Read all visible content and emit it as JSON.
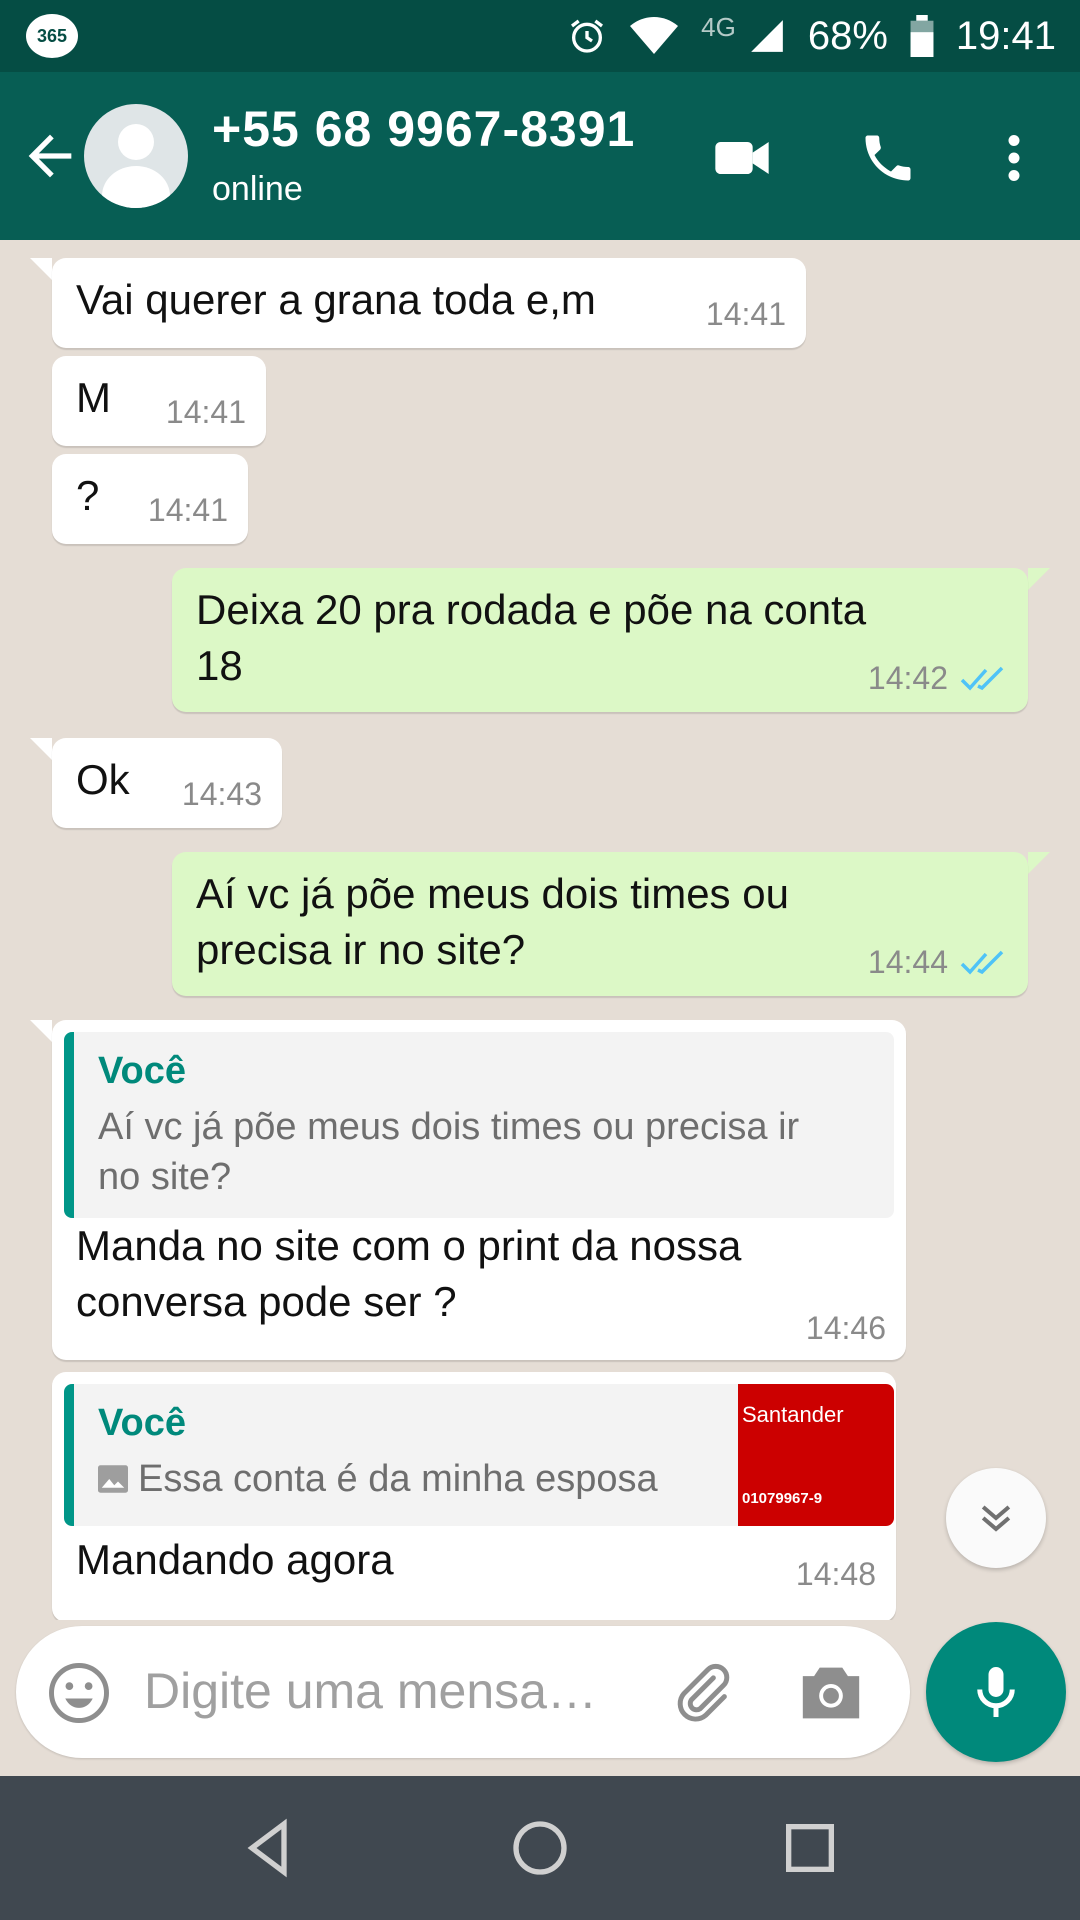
{
  "status_bar": {
    "app_badge": "365",
    "network": "4G",
    "battery": "68%",
    "time": "19:41",
    "icons": [
      "alarm-icon",
      "wifi-icon",
      "signal-icon",
      "battery-icon"
    ]
  },
  "header": {
    "contact_name": "+55 68 9967-8391",
    "contact_status": "online",
    "icons": [
      "back-arrow-icon",
      "avatar-placeholder",
      "video-call-icon",
      "phone-icon",
      "more-vert-icon"
    ]
  },
  "messages": [
    {
      "direction": "in",
      "text": "Vai querer a grana toda e,m",
      "time": "14:41"
    },
    {
      "direction": "in",
      "text": "M",
      "time": "14:41"
    },
    {
      "direction": "in",
      "text": "?",
      "time": "14:41"
    },
    {
      "direction": "out",
      "text_line1": "Deixa 20 pra rodada e põe na conta",
      "text_line2": "18",
      "time": "14:42",
      "status": "read"
    },
    {
      "direction": "in",
      "text": "Ok",
      "time": "14:43"
    },
    {
      "direction": "out",
      "text_line1": "Aí vc já põe meus dois times ou",
      "text_line2": "precisa ir no site?",
      "time": "14:44",
      "status": "read"
    },
    {
      "direction": "in",
      "quote_author": "Você",
      "quote_line1": "Aí vc já põe meus dois times ou precisa ir",
      "quote_line2": "no site?",
      "text_line1": "Manda no site com o print da nossa",
      "text_line2": "conversa pode ser ?",
      "time": "14:46"
    },
    {
      "direction": "in",
      "quote_author": "Você",
      "quote_text": "Essa conta é da minha esposa",
      "quote_thumb_brand": "Santander",
      "quote_thumb_account": "01079967-9",
      "text": "Mandando agora",
      "time": "14:48"
    }
  ],
  "composer": {
    "placeholder": "Digite uma mensa…",
    "icons": [
      "emoji-icon",
      "attach-icon",
      "camera-icon",
      "mic-icon"
    ]
  },
  "nav_bar": {
    "icons": [
      "back-triangle-icon",
      "home-circle-icon",
      "recents-square-icon"
    ]
  },
  "colors": {
    "header": "#075e54",
    "status_bar": "#054d44",
    "chat_bg": "#e5ddd5",
    "outgoing_bubble": "#dcf8c6",
    "accent": "#00897b",
    "read_ticks": "#4fc3f7"
  }
}
